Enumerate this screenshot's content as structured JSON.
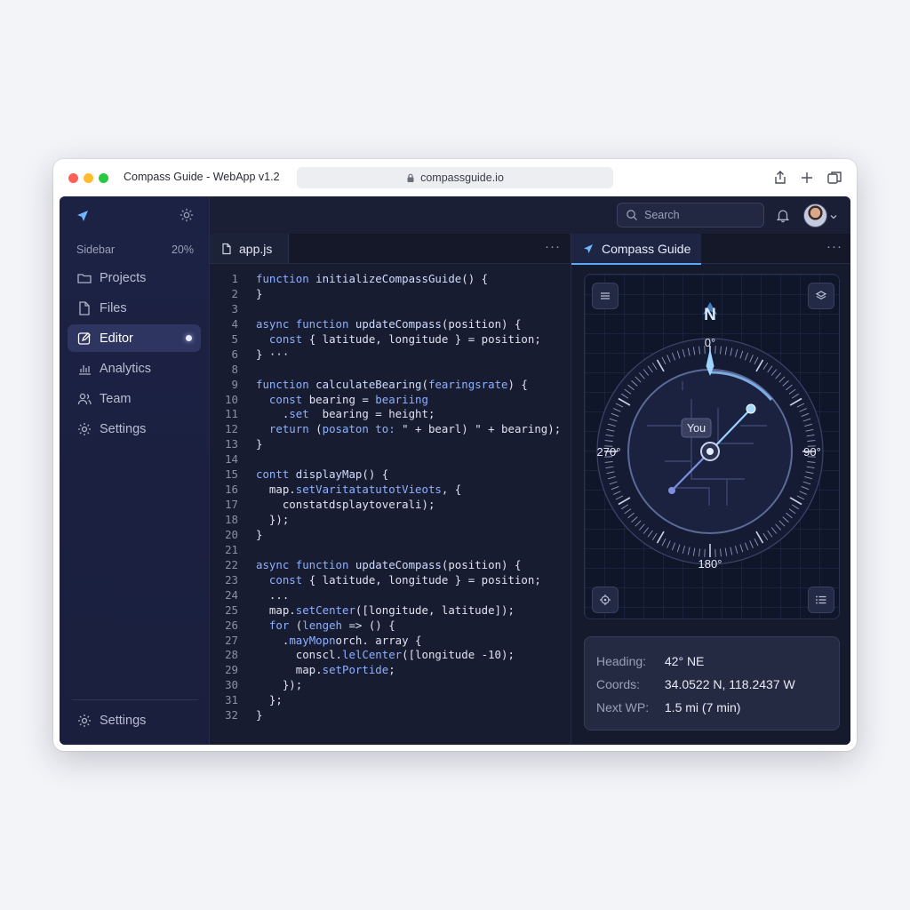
{
  "window": {
    "title": "Compass Guide - WebApp v1.2",
    "url": "compassguide.io"
  },
  "sidebar": {
    "header": "Sidebar",
    "percent": "20%",
    "items": [
      {
        "label": "Projects",
        "icon": "folder-icon"
      },
      {
        "label": "Files",
        "icon": "file-icon"
      },
      {
        "label": "Editor",
        "icon": "edit-icon",
        "active": true
      },
      {
        "label": "Analytics",
        "icon": "analytics-icon"
      },
      {
        "label": "Team",
        "icon": "team-icon"
      },
      {
        "label": "Settings",
        "icon": "gear-icon"
      }
    ],
    "footer_label": "Settings"
  },
  "topbar": {
    "search_placeholder": "Search"
  },
  "editor": {
    "tab_label": "app.js",
    "more": "···",
    "lines": [
      {
        "n": "1",
        "h": "<span class='kw'>function</span> <span class='fn'>initializeCompassGuide</span>() {"
      },
      {
        "n": "2",
        "h": "}"
      },
      {
        "n": "3",
        "h": ""
      },
      {
        "n": "4",
        "h": "<span class='kw'>async function</span> <span class='fn'>updateCompass</span>(position) {"
      },
      {
        "n": "5",
        "h": "  <span class='kw'>const</span> { latitude, longitude } = position;"
      },
      {
        "n": "6",
        "h": "} ···"
      },
      {
        "n": "8",
        "h": ""
      },
      {
        "n": "9",
        "h": "<span class='kw'>function</span> <span class='fn'>calculateBearing</span>(<span class='kw'>fearingsrate</span>) {"
      },
      {
        "n": "10",
        "h": "  <span class='kw'>const</span> bearing = <span class='kw'>beariing</span>"
      },
      {
        "n": "11",
        "h": "    .<span class='kw'>set</span>  bearing = height;"
      },
      {
        "n": "12",
        "h": "  <span class='kw'>return</span> (<span class='kw'>posaton to:</span> \" + bearl) \" + bearing);"
      },
      {
        "n": "13",
        "h": "}"
      },
      {
        "n": "14",
        "h": ""
      },
      {
        "n": "15",
        "h": "<span class='kw'>contt</span> <span class='fn'>displayMap</span>() {"
      },
      {
        "n": "16",
        "h": "  map.<span class='kw'>setVaritatatutotVieots</span>, {"
      },
      {
        "n": "17",
        "h": "    constatdsplaytoverali);"
      },
      {
        "n": "18",
        "h": "  });"
      },
      {
        "n": "20",
        "h": "}"
      },
      {
        "n": "21",
        "h": ""
      },
      {
        "n": "22",
        "h": "<span class='kw'>async function</span> <span class='fn'>updateCompass</span>(position) {"
      },
      {
        "n": "23",
        "h": "  <span class='kw'>const</span> { latitude, longitude } = position;"
      },
      {
        "n": "24",
        "h": "  ..."
      },
      {
        "n": "25",
        "h": "  map.<span class='kw'>setCenter</span>([longitude, latitude]);"
      },
      {
        "n": "26",
        "h": "  <span class='kw'>for</span> (<span class='kw'>lengeh</span> => () {"
      },
      {
        "n": "27",
        "h": "    .<span class='kw'>mayMopn</span>orch. array {"
      },
      {
        "n": "28",
        "h": "      conscl.<span class='kw'>lelCenter</span>([longitude -10);"
      },
      {
        "n": "29",
        "h": "      map.<span class='kw'>setPortide</span>;"
      },
      {
        "n": "30",
        "h": "    });"
      },
      {
        "n": "31",
        "h": "  };"
      },
      {
        "n": "32",
        "h": "}"
      }
    ]
  },
  "compass_panel": {
    "tab_label": "Compass Guide",
    "more": "···",
    "labels": {
      "north": "N",
      "n_deg": "0°",
      "east": "90°",
      "south": "180°",
      "west": "270°",
      "you": "You"
    },
    "heading_angle_deg": 42,
    "info": [
      {
        "key": "Heading:",
        "value": "42° NE"
      },
      {
        "key": "Coords:",
        "value": "34.0522 N, 118.2437 W"
      },
      {
        "key": "Next WP:",
        "value": "1.5 mi (7 min)"
      }
    ]
  },
  "colors": {
    "accent": "#5aa8ff",
    "app_bg": "#151a2c",
    "sidebar_bg": "#1c2244"
  }
}
